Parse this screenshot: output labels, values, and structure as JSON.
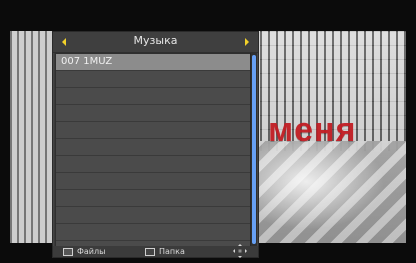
{
  "popup": {
    "title": "Музыка",
    "items": [
      "007 1MUZ"
    ],
    "footer": {
      "left_label": "Файлы",
      "mid_label": "Папка"
    }
  },
  "background": {
    "overlay_text": "меня"
  },
  "colors": {
    "panel_bg": "#3a3a3a",
    "list_bg": "#4a4a4a",
    "selected_row_bg": "#8c8c8c",
    "arrow_yellow": "#f2d12a",
    "scroll_blue": "#6aa7ff",
    "overlay_red": "#c21d24"
  },
  "icons": {
    "left_arrow": "chevron-left-icon",
    "right_arrow": "chevron-right-icon",
    "dpad": "dpad-icon"
  }
}
